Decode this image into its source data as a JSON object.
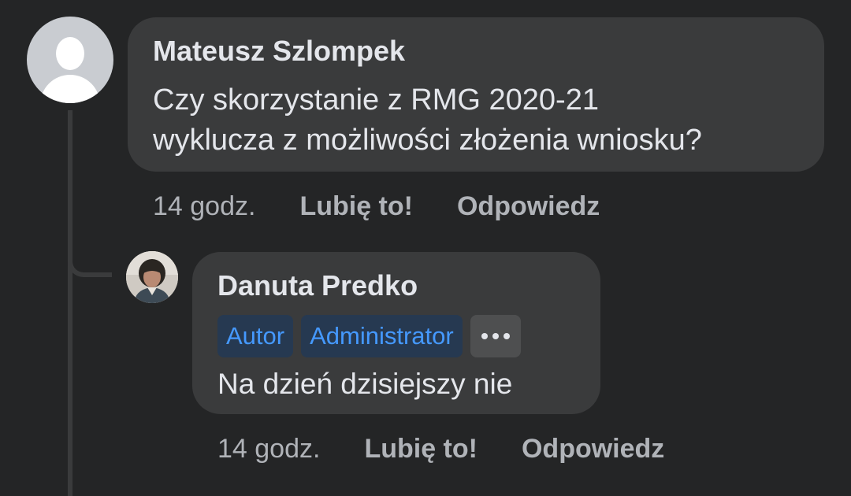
{
  "comments": [
    {
      "author": "Mateusz Szlompek",
      "text_line1": "Czy skorzystanie z RMG 2020-21",
      "text_line2": "wyklucza z możliwości złożenia wniosku?",
      "time": "14 godz.",
      "like_label": "Lubię to!",
      "reply_label": "Odpowiedz",
      "avatar": "default-avatar-icon"
    },
    {
      "author": "Danuta Predko",
      "badges": [
        "Autor",
        "Administrator"
      ],
      "more_icon": "more-horizontal-icon",
      "text": "Na dzień dzisiejszy nie",
      "time": "14 godz.",
      "like_label": "Lubię to!",
      "reply_label": "Odpowiedz",
      "avatar": "profile-photo"
    }
  ],
  "colors": {
    "background": "#242526",
    "bubble": "#3a3b3c",
    "text_primary": "#e4e6eb",
    "text_secondary": "#b0b3b8",
    "badge_bg": "#263951",
    "badge_text": "#4599ff"
  }
}
